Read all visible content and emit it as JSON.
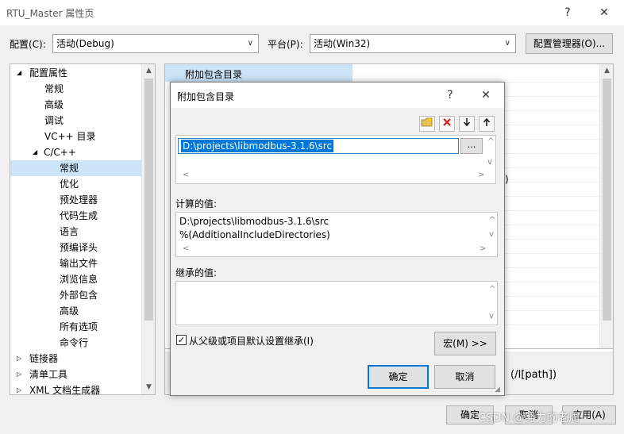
{
  "window": {
    "title": "RTU_Master 属性页",
    "help_btn": "?",
    "close_btn": "✕"
  },
  "toolbar": {
    "config_label": "配置(C):",
    "config_value": "活动(Debug)",
    "platform_label": "平台(P):",
    "platform_value": "活动(Win32)",
    "config_manager_btn": "配置管理器(O)..."
  },
  "tree": {
    "items": [
      {
        "label": "配置属性",
        "expander": "◢"
      },
      {
        "label": "常规"
      },
      {
        "label": "高级"
      },
      {
        "label": "调试"
      },
      {
        "label": "VC++ 目录"
      },
      {
        "label": "C/C++",
        "expander": "◢"
      },
      {
        "label": "常规"
      },
      {
        "label": "优化"
      },
      {
        "label": "预处理器"
      },
      {
        "label": "代码生成"
      },
      {
        "label": "语言"
      },
      {
        "label": "预编译头"
      },
      {
        "label": "输出文件"
      },
      {
        "label": "浏览信息"
      },
      {
        "label": "外部包含"
      },
      {
        "label": "高级"
      },
      {
        "label": "所有选项"
      },
      {
        "label": "命令行"
      },
      {
        "label": "链接器",
        "expander": "▷"
      },
      {
        "label": "清单工具",
        "expander": "▷"
      },
      {
        "label": "XML 文档生成器",
        "expander": "▷"
      }
    ],
    "selected_index": 6
  },
  "property_panel": {
    "first_row_name": "附加包含目录",
    "partial_text_right": ")",
    "desc_text": "(/I[path])"
  },
  "dialog": {
    "title": "附加包含目录",
    "help_btn": "?",
    "close_btn": "✕",
    "entries": [
      "D:\\projects\\libmodbus-3.1.6\\src"
    ],
    "browse_btn": "...",
    "computed_label": "计算的值:",
    "computed_values": [
      "D:\\projects\\libmodbus-3.1.6\\src",
      "%(AdditionalIncludeDirectories)"
    ],
    "inherited_label": "继承的值:",
    "inherit_checkbox_label": "从父级或项目默认设置继承(I)",
    "inherit_checked": true,
    "macro_btn": "宏(M) >>",
    "ok_btn": "确定",
    "cancel_btn": "取消"
  },
  "footer": {
    "ok_btn": "确定",
    "cancel_btn": "取消",
    "apply_btn": "应用(A)"
  },
  "watermark": "CSDN @努力的老周"
}
